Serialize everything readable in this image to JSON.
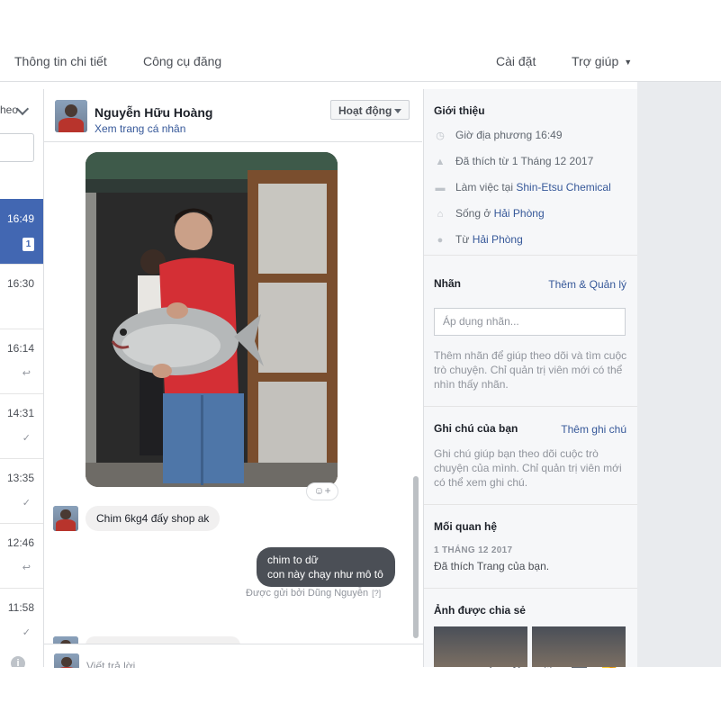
{
  "nav": {
    "details": "Thông tin chi tiết",
    "publishing_tools": "Công cụ đăng",
    "settings": "Cài đặt",
    "help": "Trợ giúp"
  },
  "thread_list": {
    "filter_label": "heo",
    "threads": [
      {
        "time": "16:49",
        "badge": "1",
        "active": true
      },
      {
        "time": "16:30",
        "status_icon": "none"
      },
      {
        "time": "16:14",
        "status_icon": "reply-icon"
      },
      {
        "time": "14:31",
        "status_icon": "check-icon"
      },
      {
        "time": "13:35",
        "status_icon": "check-icon"
      },
      {
        "time": "12:46",
        "status_icon": "reply-icon"
      },
      {
        "time": "11:58",
        "status_icon": "check-icon"
      }
    ]
  },
  "conversation": {
    "contact_name": "Nguyễn Hữu Hoàng",
    "view_profile": "Xem trang cá nhân",
    "status_button": "Hoạt động",
    "messages": {
      "incoming_text": "Chim 6kg4 đấy shop ak",
      "outgoing_line1": "chim to dữ",
      "outgoing_line2": "con này chạy như mô tô",
      "sent_by": "Được gửi bởi Dũng Nguyễn",
      "sent_by_help": "[?]"
    }
  },
  "composer": {
    "placeholder": "Viết trả lời..."
  },
  "info_panel": {
    "intro": {
      "title": "Giới thiệu",
      "local_time": "Giờ địa phương 16:49",
      "liked": "Đã thích từ 1 Tháng 12 2017",
      "work_prefix": "Làm việc tại",
      "work_place": "Shin-Etsu Chemical",
      "lives_prefix": "Sống ở",
      "lives_place": "Hải Phòng",
      "from_prefix": "Từ",
      "from_place": "Hải Phòng"
    },
    "labels": {
      "title": "Nhãn",
      "action": "Thêm & Quản lý",
      "input_placeholder": "Áp dụng nhãn...",
      "help": "Thêm nhãn để giúp theo dõi và tìm cuộc trò chuyện. Chỉ quản trị viên mới có thể nhìn thấy nhãn."
    },
    "notes": {
      "title": "Ghi chú của bạn",
      "action": "Thêm ghi chú",
      "help": "Ghi chú giúp bạn theo dõi cuộc trò chuyện của mình. Chỉ quản trị viên mới có thể xem ghi chú."
    },
    "relationship": {
      "title": "Mối quan hệ",
      "date": "1 THÁNG 12 2017",
      "text": "Đã thích Trang của bạn."
    },
    "shared_photos": {
      "title": "Ảnh được chia sẻ"
    }
  },
  "colors": {
    "brand_blue": "#4267b2",
    "link_blue": "#365899",
    "outgoing_bubble": "#4b4f56",
    "incoming_bubble": "#f1f0f0"
  }
}
